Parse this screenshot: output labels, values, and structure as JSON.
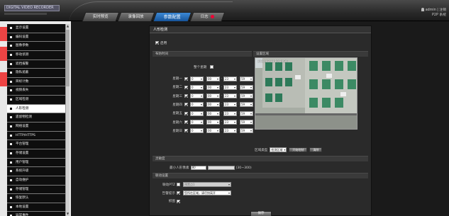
{
  "header": {
    "logo_text": "DIGITAL VIDEO RECORDER",
    "tabs": [
      {
        "label": "实时预览"
      },
      {
        "label": "录像回放"
      },
      {
        "label": "参数配置"
      },
      {
        "label": "日志"
      }
    ],
    "user_line1": "admin | 注销",
    "user_line2": "P2P 系统"
  },
  "sidebar": {
    "items": [
      {
        "label": "显示设置"
      },
      {
        "label": "编码设置"
      },
      {
        "label": "图像参数"
      },
      {
        "label": "移动侦测"
      },
      {
        "label": "遮挡报警"
      },
      {
        "label": "隐私遮蔽"
      },
      {
        "label": "目标计数"
      },
      {
        "label": "视频丢失"
      },
      {
        "label": "区域检测"
      },
      {
        "label": "人形检测"
      },
      {
        "label": "遗留物检测"
      },
      {
        "label": "网络设置"
      },
      {
        "label": "HTTP/HTTPS"
      },
      {
        "label": "平台管理"
      },
      {
        "label": "存储设置"
      },
      {
        "label": "用户管理"
      },
      {
        "label": "系统升级"
      },
      {
        "label": "自动维护"
      },
      {
        "label": "存储管理"
      },
      {
        "label": "恢复默认"
      },
      {
        "label": "本地设置"
      },
      {
        "label": "异常事件"
      }
    ]
  },
  "panel": {
    "title": "人形检测",
    "enable_label": "启用",
    "section_schedule": "布防时间",
    "section_area": "设置区域",
    "allday_label": "整个星期",
    "days": [
      {
        "label": "星期一",
        "h1": "0",
        "m1": "00",
        "h2": "23",
        "m2": "59"
      },
      {
        "label": "星期二",
        "h1": "0",
        "m1": "00",
        "h2": "23",
        "m2": "59"
      },
      {
        "label": "星期三",
        "h1": "0",
        "m1": "00",
        "h2": "23",
        "m2": "59"
      },
      {
        "label": "星期四",
        "h1": "0",
        "m1": "00",
        "h2": "23",
        "m2": "59"
      },
      {
        "label": "星期五",
        "h1": "0",
        "m1": "00",
        "h2": "23",
        "m2": "59"
      },
      {
        "label": "星期六",
        "h1": "0",
        "m1": "00",
        "h2": "23",
        "m2": "59"
      },
      {
        "label": "星期日",
        "h1": "0",
        "m1": "00",
        "h2": "23",
        "m2": "59"
      }
    ],
    "video_osd": "2021-03-18 10:24:36",
    "region_label": "区域类型",
    "region_value": "检测区域",
    "start_draw_label": "开始绘制",
    "clear_label": "清除",
    "section_sensitivity": "灵敏度",
    "sensitivity_label": "最小人形像素",
    "sensitivity_value": "80",
    "sensitivity_range": "(30~300)",
    "section_linkage": "联动设置",
    "ptz_label": "联动PTZ",
    "ptz_value": "预置点1",
    "alarm_label": "告警提示",
    "alarm_value": "您所在区域，请尽快离开",
    "snapshot_label": "抓图",
    "save_label": "保存"
  },
  "colors": {
    "active_tab": "#2a6fb8",
    "sidebar_bg": "#0e0e0e",
    "main_bg": "#2a2a2a",
    "accent_mark": "#e44"
  }
}
